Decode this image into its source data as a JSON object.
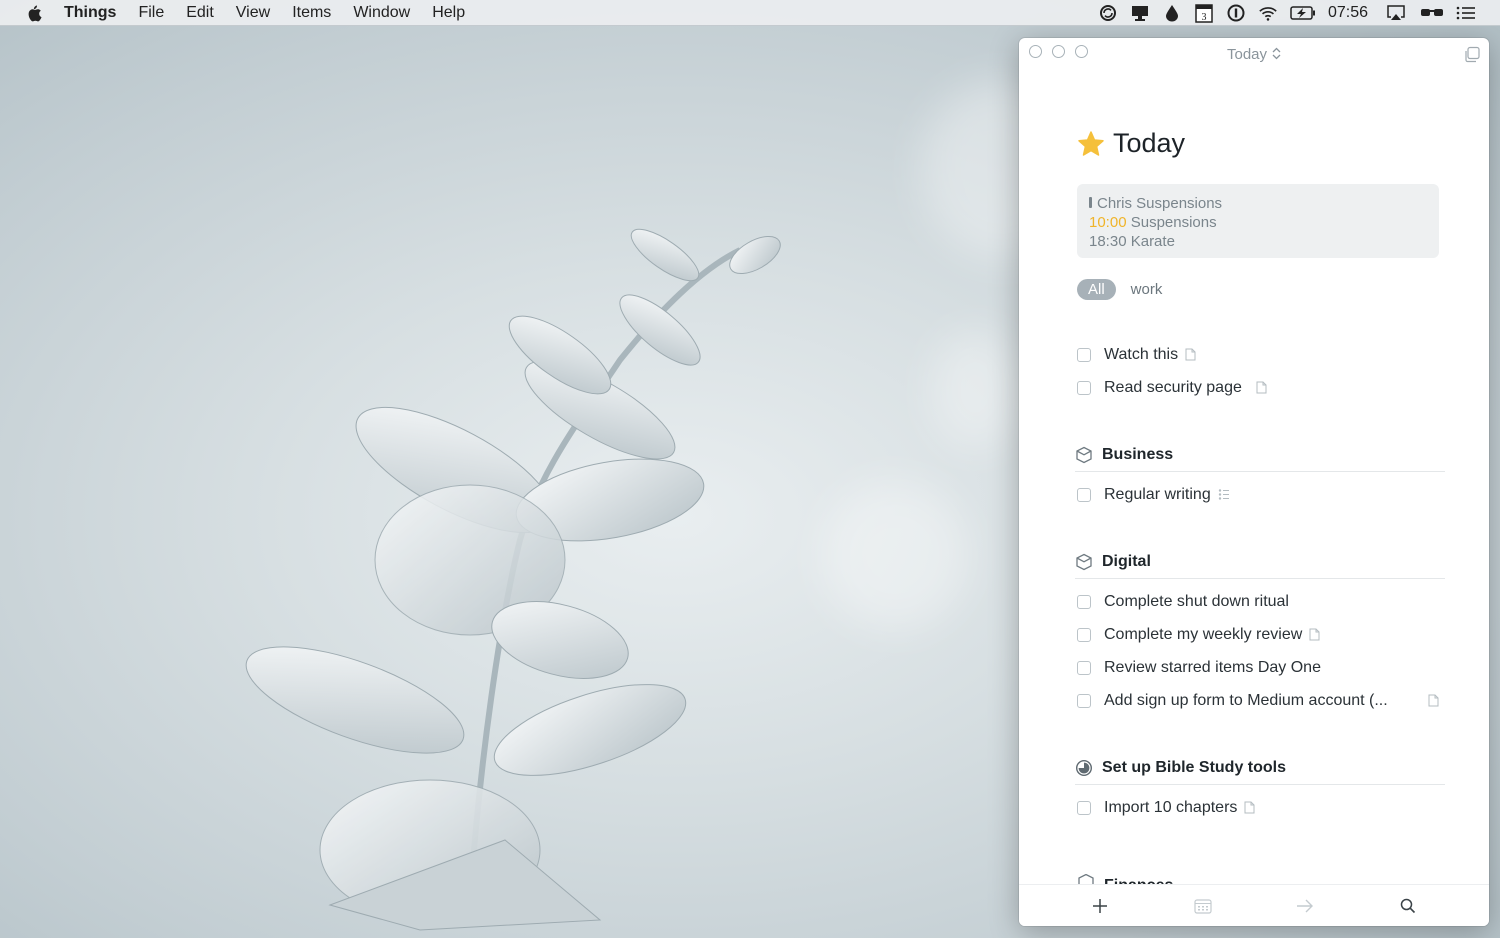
{
  "menubar": {
    "app_name": "Things",
    "menus": [
      "File",
      "Edit",
      "View",
      "Items",
      "Window",
      "Help"
    ],
    "status_icons": [
      "sync-icon",
      "display-icon",
      "drop-icon",
      "calendar-icon",
      "onepassword-icon",
      "wifi-icon",
      "battery-charging-icon"
    ],
    "calendar_day": "3",
    "clock": "07:56",
    "right_icons": [
      "airplay-icon",
      "glasses-icon",
      "list-icon"
    ]
  },
  "window": {
    "title": "Today",
    "heading": "Today",
    "calendar_events": [
      {
        "time": "",
        "title": "Chris Suspensions",
        "all_day": true
      },
      {
        "time": "10:00",
        "title": "Suspensions",
        "accent": true
      },
      {
        "time": "18:30",
        "title": "Karate"
      }
    ],
    "tags": [
      {
        "label": "All",
        "active": true
      },
      {
        "label": "work",
        "active": false
      }
    ],
    "loose_tasks": [
      {
        "title": "Watch this",
        "has_note": true
      },
      {
        "title": "Read security page",
        "has_note": true
      }
    ],
    "sections": [
      {
        "title": "Business",
        "icon": "area-box-icon",
        "tasks": [
          {
            "title": "Regular writing",
            "has_checklist": true
          }
        ]
      },
      {
        "title": "Digital",
        "icon": "area-box-icon",
        "tasks": [
          {
            "title": "Complete shut down ritual"
          },
          {
            "title": "Complete my weekly review",
            "has_note": true
          },
          {
            "title": "Review starred items Day One"
          },
          {
            "title": "Add sign up form to Medium account (...",
            "has_note": true
          }
        ]
      },
      {
        "title": "Set up Bible Study tools",
        "icon": "project-progress-icon",
        "progress": 0.75,
        "tasks": [
          {
            "title": "Import 10 chapters",
            "has_note": true
          }
        ]
      }
    ],
    "clipped_section": "Finances",
    "toolbar": [
      "add-icon",
      "calendar-icon",
      "move-arrow-icon",
      "search-icon"
    ],
    "colors": {
      "star": "#f5c03b",
      "accent_time": "#f0b429",
      "tag_active_bg": "#a7b1b8"
    }
  }
}
